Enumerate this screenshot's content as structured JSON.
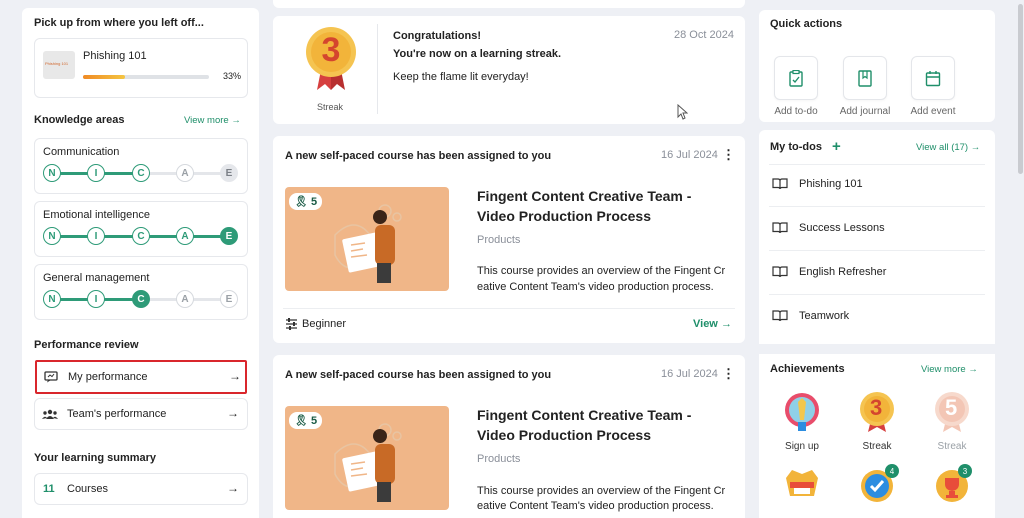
{
  "left": {
    "continue_title": "Pick up from where you left off...",
    "course": {
      "name": "Phishing 101",
      "progress_label": "33%",
      "progress": 0.33,
      "thumb_caption": "Phishing 101"
    },
    "knowledge": {
      "title": "Knowledge areas",
      "view_more": "View more",
      "areas": [
        {
          "name": "Communication",
          "levels": [
            "N",
            "I",
            "C",
            "A",
            "E"
          ]
        },
        {
          "name": "Emotional intelligence",
          "levels": [
            "N",
            "I",
            "C",
            "A",
            "E"
          ]
        },
        {
          "name": "General management",
          "levels": [
            "N",
            "I",
            "C",
            "A",
            "E"
          ]
        }
      ]
    },
    "performance": {
      "title": "Performance review",
      "my": "My performance",
      "team": "Team's performance"
    },
    "summary": {
      "title": "Your learning summary",
      "count": "11",
      "label": "Courses"
    }
  },
  "streak": {
    "medal_number": "3",
    "medal_label": "Streak",
    "heading": "Congratulations!",
    "subheading": "You're now on a learning streak.",
    "body": "Keep the flame lit everyday!",
    "date": "28 Oct 2024"
  },
  "feed": [
    {
      "header": "A new self-paced course has been assigned to you",
      "date": "16 Jul 2024",
      "badge": "5",
      "title_line1": "Fingent Content Creative Team -",
      "title_line2": "Video Production Process",
      "category": "Products",
      "desc_line1": "This course provides an overview of the Fingent Cr",
      "desc_line2": "eative Content Team's video production process.",
      "level": "Beginner",
      "view": "View"
    },
    {
      "header": "A new self-paced course has been assigned to you",
      "date": "16 Jul 2024",
      "badge": "5",
      "title_line1": "Fingent Content Creative Team -",
      "title_line2": "Video Production Process",
      "category": "Products",
      "desc_line1": "This course provides an overview of the Fingent Cr",
      "desc_line2": "eative Content Team's video production process."
    }
  ],
  "quick": {
    "title": "Quick actions",
    "items": [
      {
        "label": "Add to-do",
        "icon": "checklist-icon"
      },
      {
        "label": "Add journal",
        "icon": "journal-icon"
      },
      {
        "label": "Add event",
        "icon": "calendar-icon"
      }
    ]
  },
  "todos": {
    "title": "My to-dos",
    "view_all": "View all (17)",
    "items": [
      "Phishing 101",
      "Success Lessons",
      "English Refresher",
      "Teamwork"
    ]
  },
  "achievements": {
    "title": "Achievements",
    "view_more": "View more",
    "items": [
      {
        "label": "Sign up",
        "color": "#e84d6b"
      },
      {
        "label": "Streak",
        "number": "3",
        "color": "#f2b43a"
      },
      {
        "label": "Streak",
        "number": "5",
        "color": "#f3c6b5"
      },
      {
        "label": "",
        "color": "#f2b43a"
      },
      {
        "label": "",
        "count": "4",
        "color": "#2c8de0"
      },
      {
        "label": "",
        "count": "3",
        "color": "#e84d3a"
      }
    ]
  },
  "colors": {
    "accent": "#2e9b78",
    "highlight_border": "#d9262c",
    "thumb_bg": "#f0b688"
  }
}
